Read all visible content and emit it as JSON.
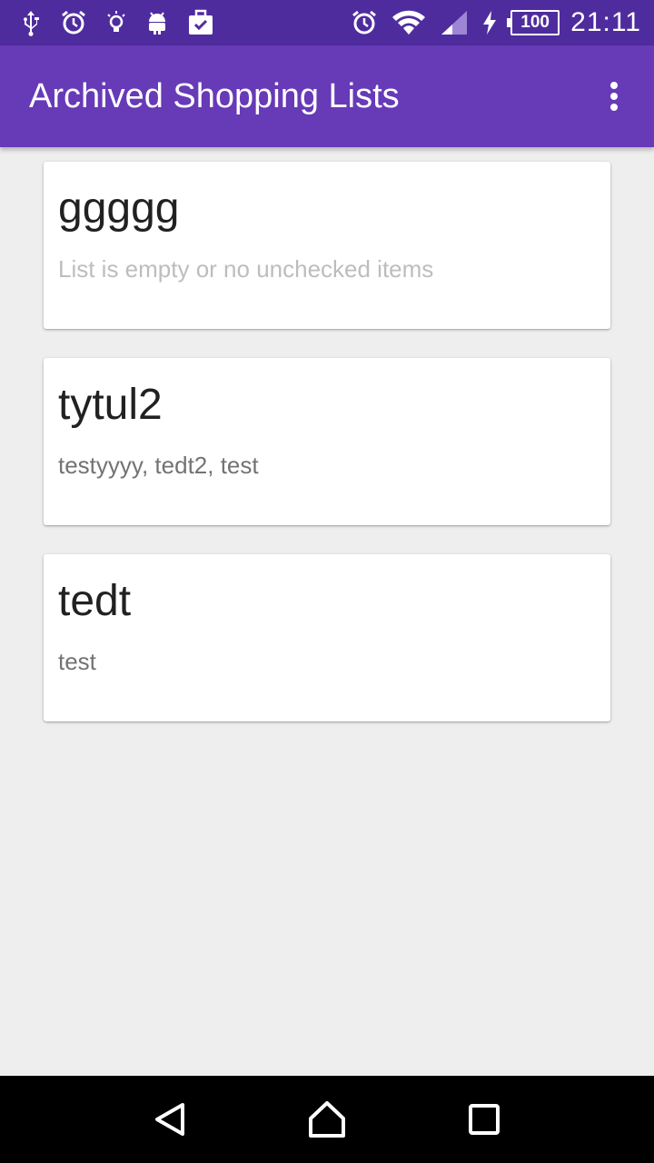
{
  "status_bar": {
    "time": "21:11",
    "battery_level": "100",
    "left_icons": [
      "usb-icon",
      "alarm-clock-icon",
      "lightbulb-icon",
      "android-icon",
      "briefcase-check-icon"
    ],
    "right_icons": [
      "alarm-icon",
      "wifi-icon",
      "signal-icon",
      "charging-icon",
      "battery-icon"
    ]
  },
  "app_bar": {
    "title": "Archived Shopping Lists",
    "overflow_icon": "more-vert-icon",
    "background": "#673ab7",
    "status_background": "#4f2c9e"
  },
  "lists": [
    {
      "title": "ggggg",
      "items": "List is empty or no unchecked items",
      "empty": true
    },
    {
      "title": "tytul2",
      "items": "testyyyy, tedt2, test",
      "empty": false
    },
    {
      "title": "tedt",
      "items": "test",
      "empty": false
    }
  ],
  "nav_bar": {
    "icons": [
      "back-icon",
      "home-icon",
      "recents-icon"
    ]
  }
}
